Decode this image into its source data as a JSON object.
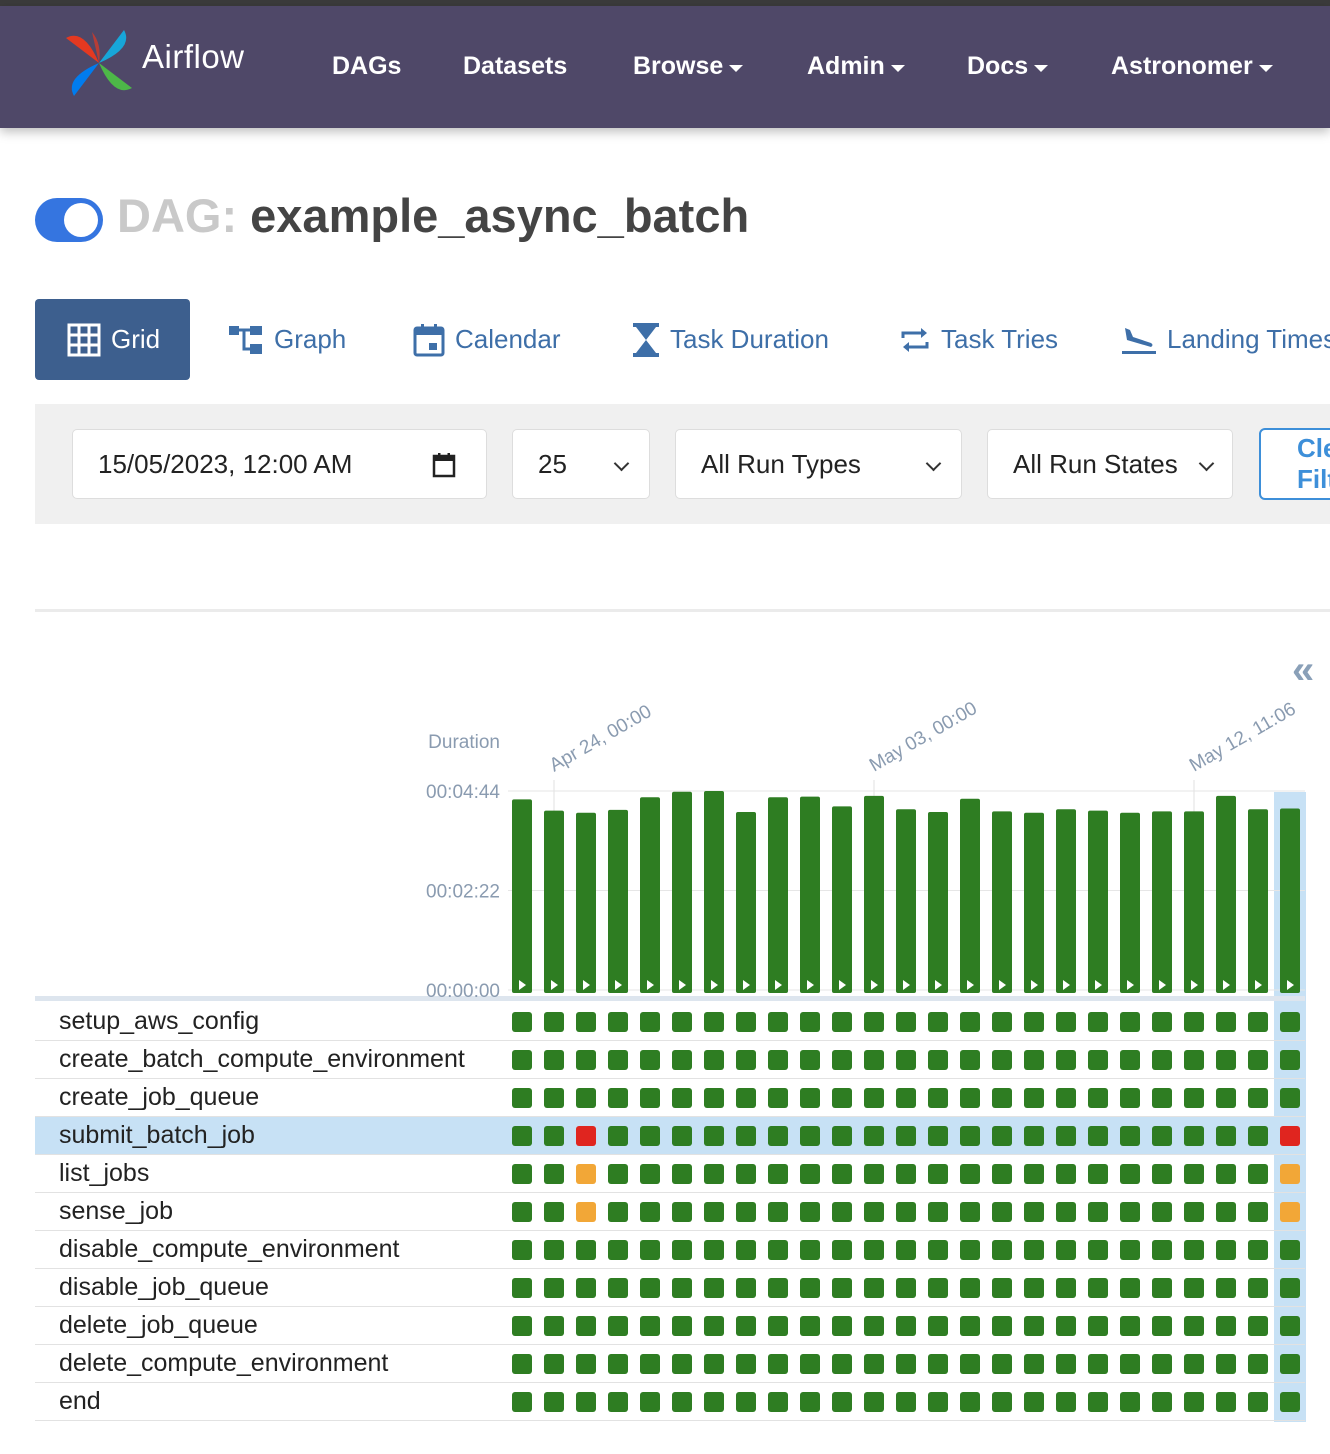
{
  "brand": {
    "name": "Airflow"
  },
  "nav": [
    {
      "label": "DAGs",
      "dropdown": false
    },
    {
      "label": "Datasets",
      "dropdown": false
    },
    {
      "label": "Browse",
      "dropdown": true
    },
    {
      "label": "Admin",
      "dropdown": true
    },
    {
      "label": "Docs",
      "dropdown": true
    },
    {
      "label": "Astronomer",
      "dropdown": true
    }
  ],
  "dag": {
    "prefix": "DAG:",
    "id": "example_async_batch",
    "paused": false
  },
  "tabs": [
    {
      "label": "Grid",
      "icon": "grid-icon",
      "active": true
    },
    {
      "label": "Graph",
      "icon": "graph-icon"
    },
    {
      "label": "Calendar",
      "icon": "calendar-icon"
    },
    {
      "label": "Task Duration",
      "icon": "hourglass-icon"
    },
    {
      "label": "Task Tries",
      "icon": "retry-icon"
    },
    {
      "label": "Landing Times",
      "icon": "plane-landing-icon"
    }
  ],
  "filters": {
    "base_date": "15/05/2023, 12:00 AM",
    "num_runs": "25",
    "run_type": "All Run Types",
    "run_state": "All Run States",
    "clear_label": "Clear Filters"
  },
  "colors": {
    "success": "#2e7d22",
    "failed": "#e0251f",
    "up_for_retry": "#f2a737",
    "accent": "#3d5f8e",
    "navbar": "#4f4868"
  },
  "chart_data": {
    "type": "bar",
    "ylabel": "Duration",
    "yticks": [
      "00:00:00",
      "00:02:22",
      "00:04:44"
    ],
    "ylim_seconds": [
      0,
      284
    ],
    "x_tick_labels": [
      "Apr 24, 00:00",
      "May 03, 00:00",
      "May 12, 11:06"
    ],
    "selected_run_index": 24,
    "series": [
      {
        "values_seconds": [
          272,
          256,
          253,
          257,
          275,
          283,
          284,
          254,
          275,
          276,
          262,
          277,
          258,
          254,
          273,
          255,
          253,
          258,
          256,
          253,
          255,
          255,
          277,
          258,
          259
        ]
      }
    ]
  },
  "tasks": [
    {
      "name": "setup_aws_config",
      "states": "sssssssssssssssssssssssss"
    },
    {
      "name": "create_batch_compute_environment",
      "states": "sssssssssssssssssssssssss"
    },
    {
      "name": "create_job_queue",
      "states": "sssssssssssssssssssssssss"
    },
    {
      "name": "submit_batch_job",
      "states": "ssfssssssssssssssssssssssf",
      "highlight": true
    },
    {
      "name": "list_jobs",
      "states": "ssrssssssssssssssssssssssr"
    },
    {
      "name": "sense_job",
      "states": "ssrssssssssssssssssssssssr"
    },
    {
      "name": "disable_compute_environment",
      "states": "sssssssssssssssssssssssss"
    },
    {
      "name": "disable_job_queue",
      "states": "sssssssssssssssssssssssss"
    },
    {
      "name": "delete_job_queue",
      "states": "sssssssssssssssssssssssss"
    },
    {
      "name": "delete_compute_environment",
      "states": "sssssssssssssssssssssssss"
    },
    {
      "name": "end",
      "states": "sssssssssssssssssssssssss"
    }
  ]
}
